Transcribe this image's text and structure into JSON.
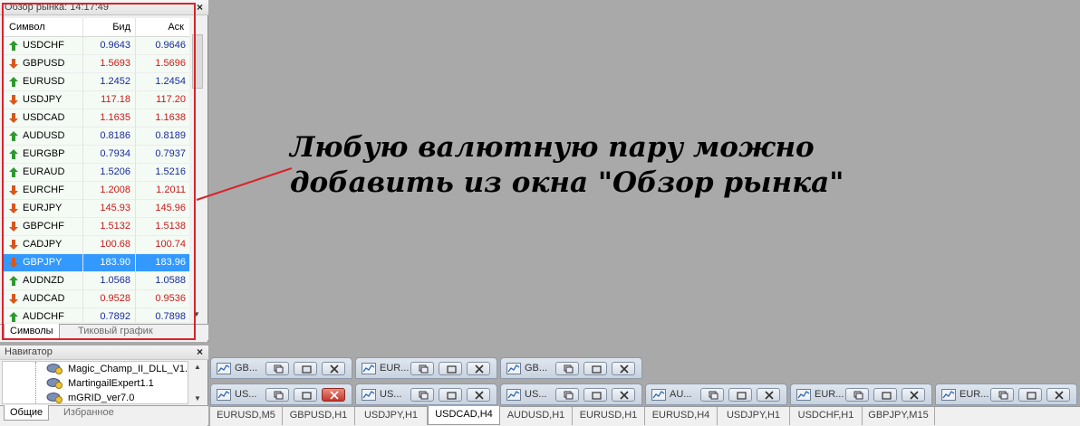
{
  "market_watch": {
    "title": "Обзор рынка: 14:17:49",
    "close_glyph": "×",
    "columns": {
      "symbol": "Символ",
      "bid": "Бид",
      "ask": "Аск"
    },
    "rows": [
      {
        "symbol": "USDCHF",
        "bid": "0.9643",
        "ask": "0.9646",
        "dir": "up"
      },
      {
        "symbol": "GBPUSD",
        "bid": "1.5693",
        "ask": "1.5696",
        "dir": "down"
      },
      {
        "symbol": "EURUSD",
        "bid": "1.2452",
        "ask": "1.2454",
        "dir": "up"
      },
      {
        "symbol": "USDJPY",
        "bid": "117.18",
        "ask": "117.20",
        "dir": "down"
      },
      {
        "symbol": "USDCAD",
        "bid": "1.1635",
        "ask": "1.1638",
        "dir": "down"
      },
      {
        "symbol": "AUDUSD",
        "bid": "0.8186",
        "ask": "0.8189",
        "dir": "up"
      },
      {
        "symbol": "EURGBP",
        "bid": "0.7934",
        "ask": "0.7937",
        "dir": "up"
      },
      {
        "symbol": "EURAUD",
        "bid": "1.5206",
        "ask": "1.5216",
        "dir": "up"
      },
      {
        "symbol": "EURCHF",
        "bid": "1.2008",
        "ask": "1.2011",
        "dir": "down"
      },
      {
        "symbol": "EURJPY",
        "bid": "145.93",
        "ask": "145.96",
        "dir": "down"
      },
      {
        "symbol": "GBPCHF",
        "bid": "1.5132",
        "ask": "1.5138",
        "dir": "down"
      },
      {
        "symbol": "CADJPY",
        "bid": "100.68",
        "ask": "100.74",
        "dir": "down"
      },
      {
        "symbol": "GBPJPY",
        "bid": "183.90",
        "ask": "183.96",
        "dir": "down",
        "selected": true
      },
      {
        "symbol": "AUDNZD",
        "bid": "1.0568",
        "ask": "1.0588",
        "dir": "up"
      },
      {
        "symbol": "AUDCAD",
        "bid": "0.9528",
        "ask": "0.9536",
        "dir": "down"
      },
      {
        "symbol": "AUDCHF",
        "bid": "0.7892",
        "ask": "0.7898",
        "dir": "up"
      }
    ],
    "tabs": {
      "symbols": "Символы",
      "tick_chart": "Тиковый график"
    }
  },
  "navigator": {
    "title": "Навигатор",
    "close_glyph": "×",
    "items": [
      "Magic_Champ_II_DLL_V1.61",
      "MartingailExpert1.1",
      "mGRID_ver7.0"
    ],
    "tabs": {
      "general": "Общие",
      "favorites": "Избранное"
    }
  },
  "minimized_windows": [
    {
      "title": "GB...",
      "row": 1,
      "col": 0
    },
    {
      "title": "EUR...",
      "row": 1,
      "col": 1
    },
    {
      "title": "GB...",
      "row": 1,
      "col": 2
    },
    {
      "title": "US...",
      "row": 2,
      "col": 0,
      "active": true
    },
    {
      "title": "US...",
      "row": 2,
      "col": 1
    },
    {
      "title": "US...",
      "row": 2,
      "col": 2
    },
    {
      "title": "AU...",
      "row": 2,
      "col": 3
    },
    {
      "title": "EUR...",
      "row": 2,
      "col": 4
    },
    {
      "title": "EUR...",
      "row": 2,
      "col": 5
    }
  ],
  "chart_tabs": [
    {
      "label": "EURUSD,M5"
    },
    {
      "label": "GBPUSD,H1"
    },
    {
      "label": "USDJPY,H1"
    },
    {
      "label": "USDCAD,H4",
      "active": true
    },
    {
      "label": "AUDUSD,H1"
    },
    {
      "label": "EURUSD,H1"
    },
    {
      "label": "EURUSD,H4"
    },
    {
      "label": "USDJPY,H1"
    },
    {
      "label": "USDCHF,H1"
    },
    {
      "label": "GBPJPY,M15"
    }
  ],
  "annotation": {
    "line1": "Любую валютную пару можно",
    "line2": "добавить из окна \"Обзор рынка\""
  },
  "colors": {
    "workspace": "#a9a9a9",
    "highlight_frame": "#d9232b",
    "price_up": "#1a2a9e",
    "price_down": "#c91a1a",
    "arrow_up": "#2e9a2e",
    "arrow_down": "#d8571c",
    "selection": "#3399ff"
  }
}
